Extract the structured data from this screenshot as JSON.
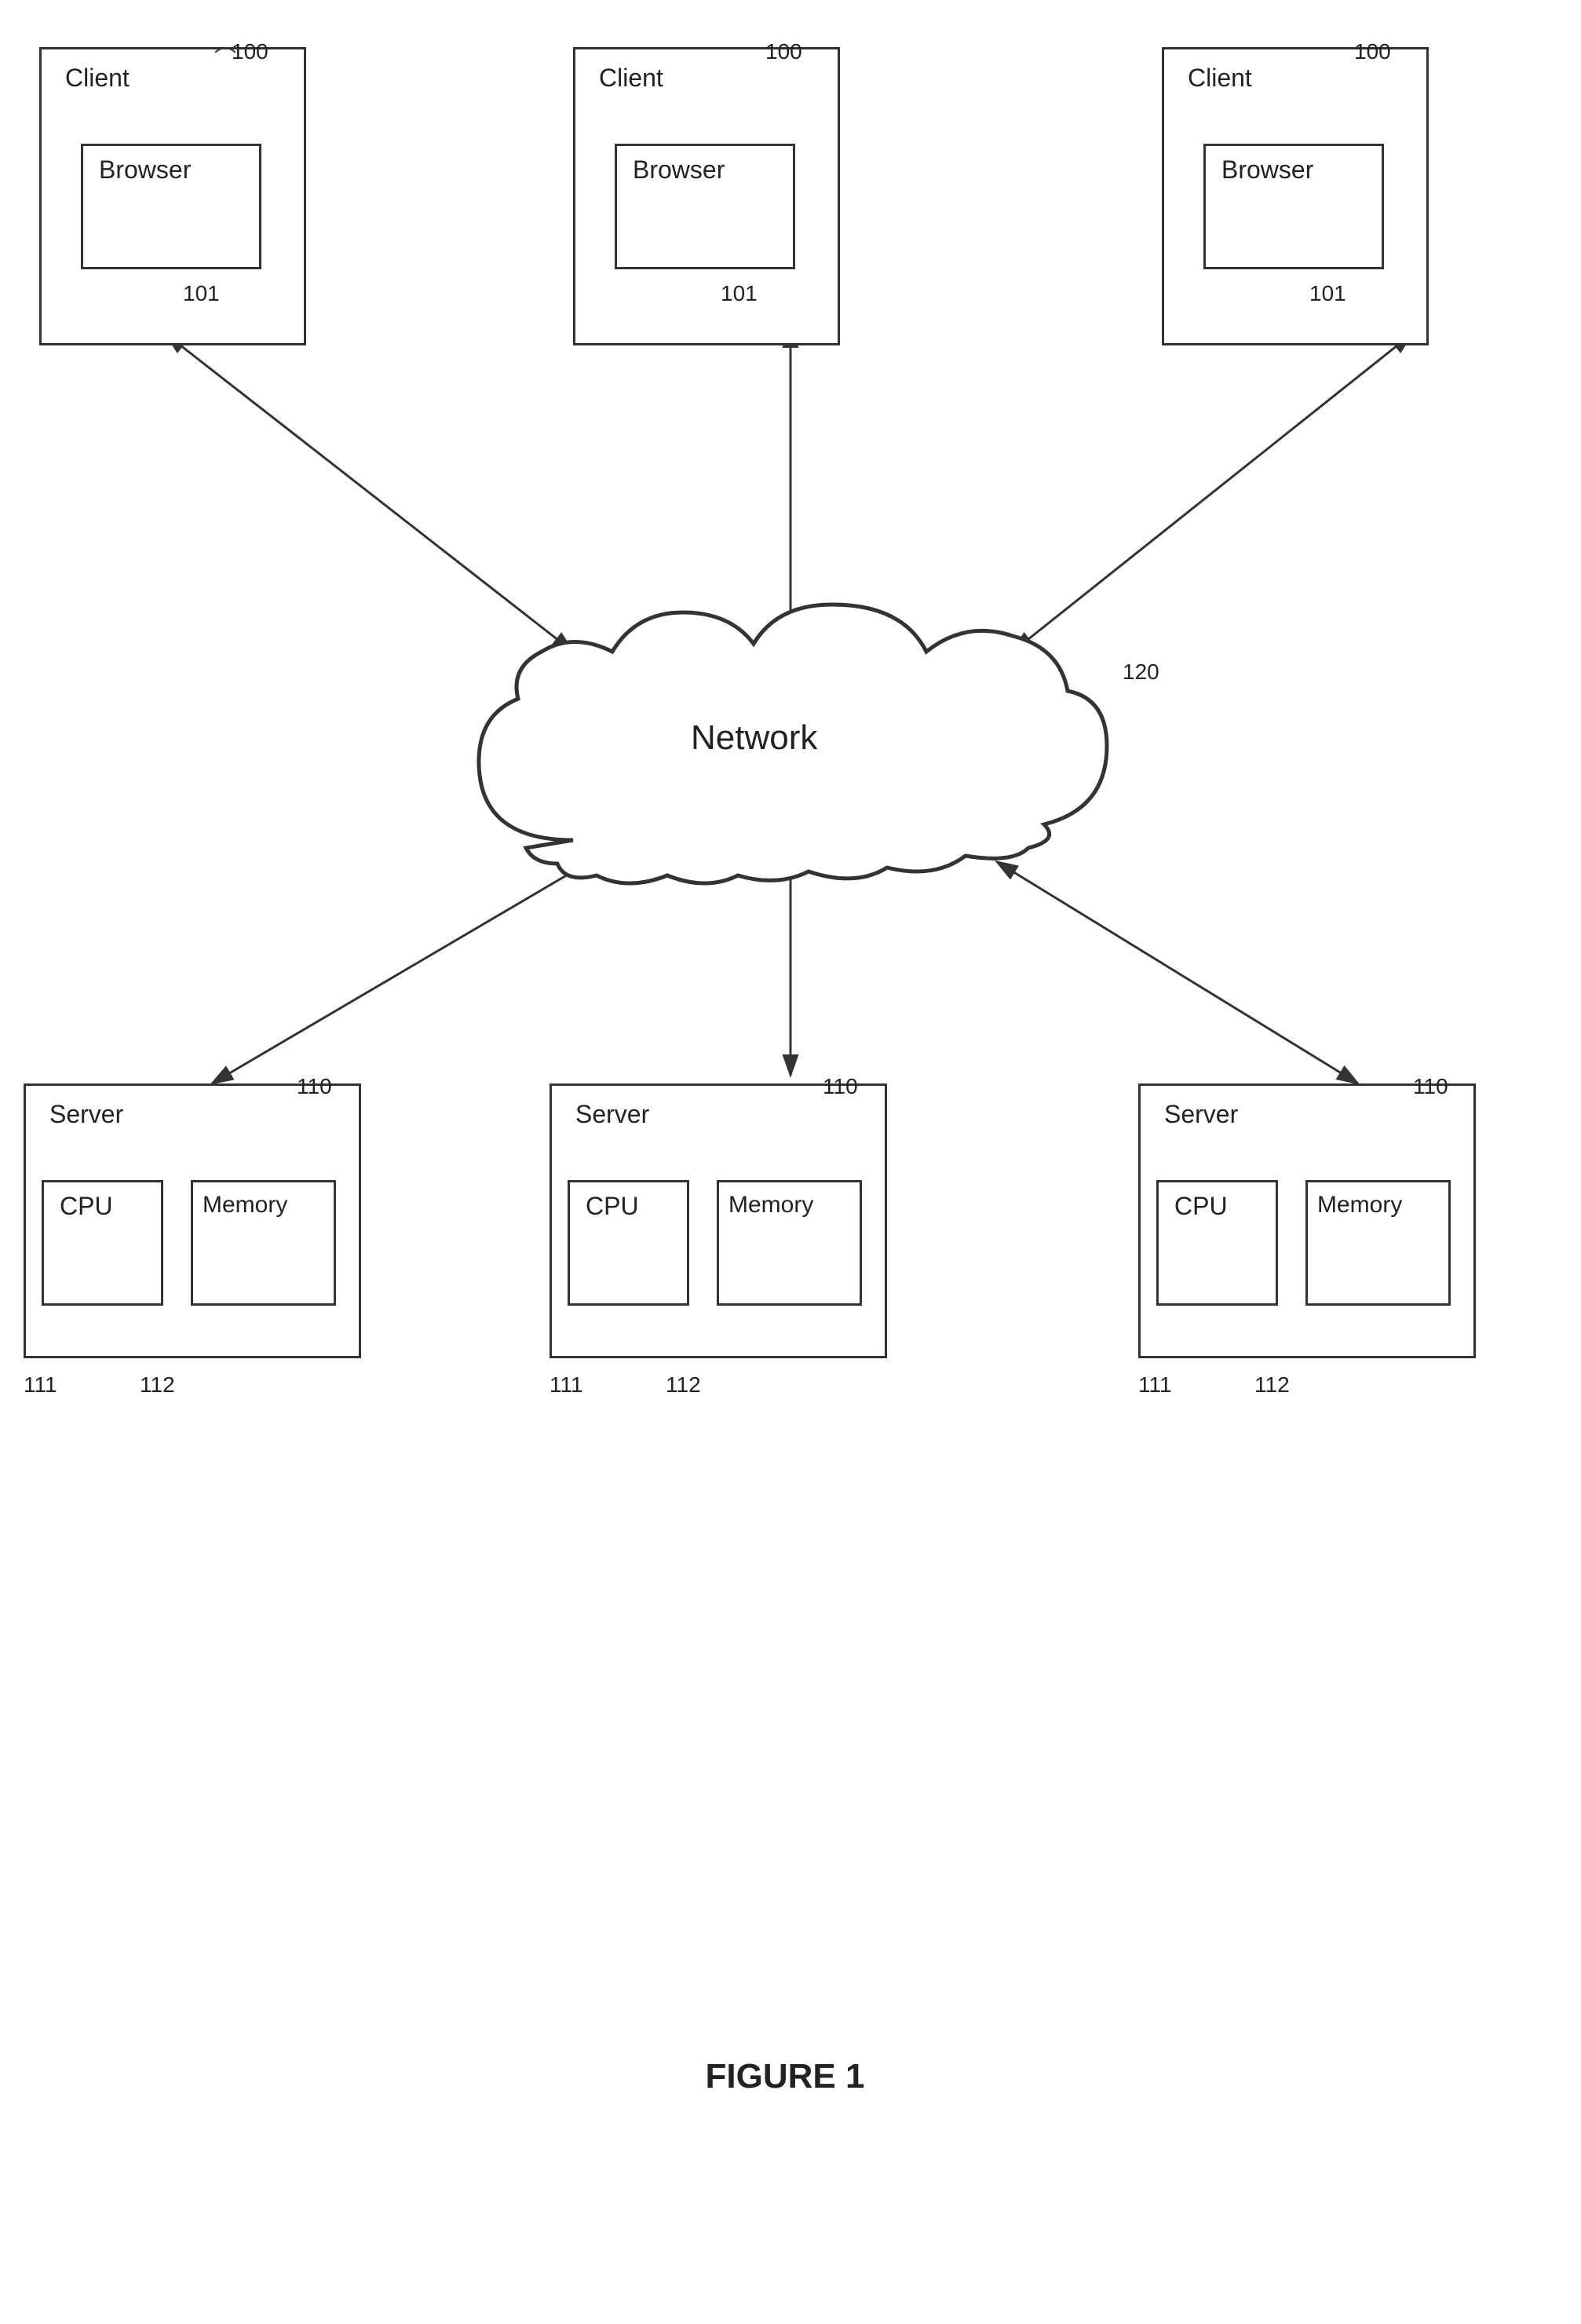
{
  "figure": {
    "title": "FIGURE 1"
  },
  "clients": [
    {
      "id": "client1",
      "label": "Client",
      "ref": "100",
      "browser_label": "Browser",
      "browser_ref": "101"
    },
    {
      "id": "client2",
      "label": "Client",
      "ref": "100",
      "browser_label": "Browser",
      "browser_ref": "101"
    },
    {
      "id": "client3",
      "label": "Client",
      "ref": "100",
      "browser_label": "Browser",
      "browser_ref": "101"
    }
  ],
  "network": {
    "label": "Network",
    "ref": "120"
  },
  "servers": [
    {
      "id": "server1",
      "label": "Server",
      "ref": "110",
      "cpu_label": "CPU",
      "cpu_ref": "111",
      "memory_label": "Memory",
      "memory_ref": "112"
    },
    {
      "id": "server2",
      "label": "Server",
      "ref": "110",
      "cpu_label": "CPU",
      "cpu_ref": "111",
      "memory_label": "Memory",
      "memory_ref": "112"
    },
    {
      "id": "server3",
      "label": "Server",
      "ref": "110",
      "cpu_label": "CPU",
      "cpu_ref": "111",
      "memory_label": "Memory",
      "memory_ref": "112"
    }
  ]
}
